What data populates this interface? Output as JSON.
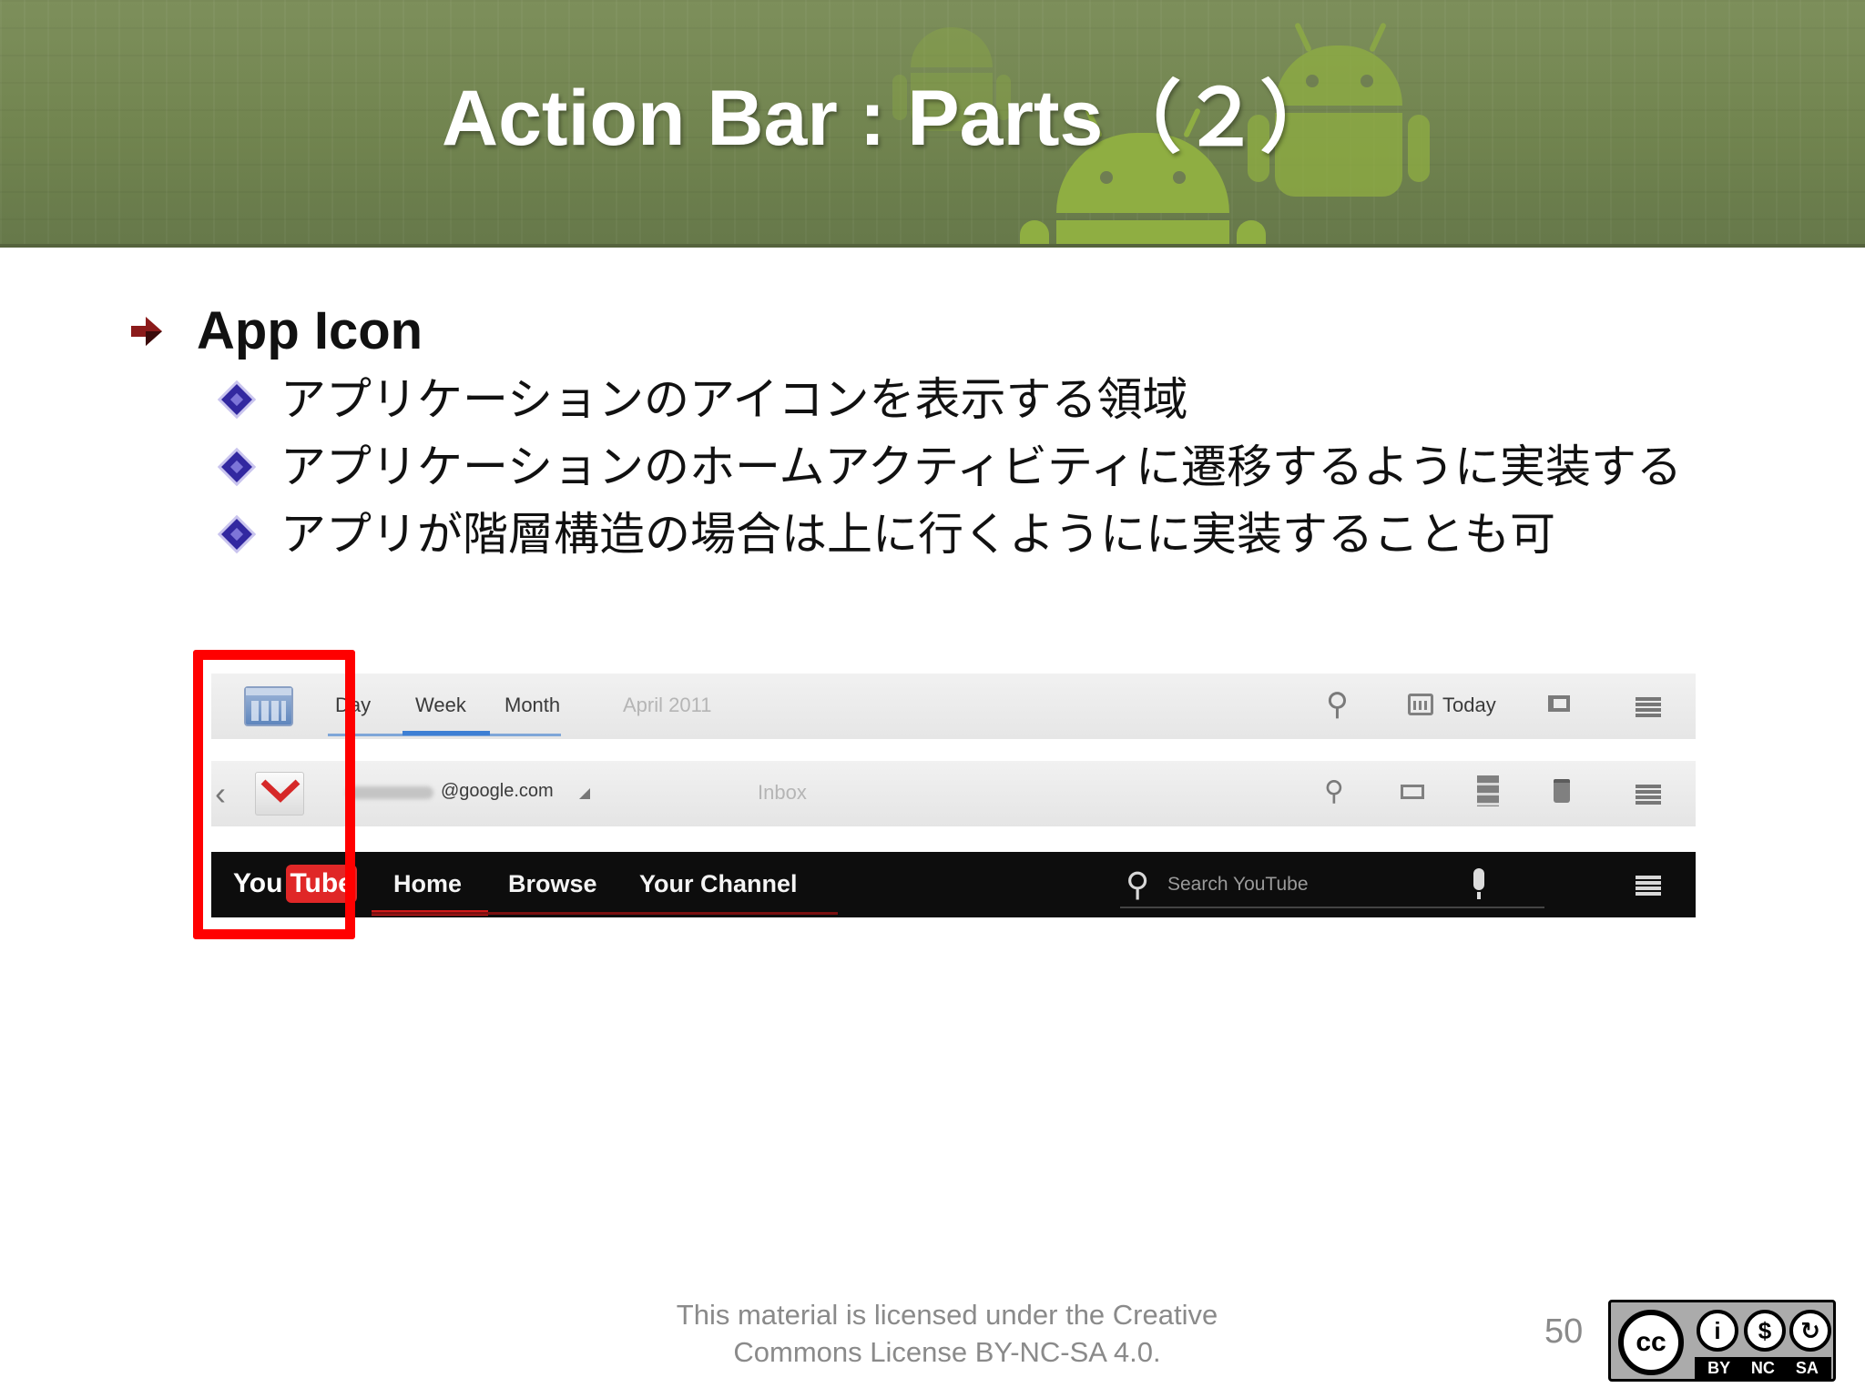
{
  "slide": {
    "title": "Action Bar : Parts（２）",
    "heading": "App Icon",
    "bullets": [
      "アプリケーションのアイコンを表示する領域",
      "アプリケーションのホームアクティビティに遷移するように実装する",
      "アプリが階層構造の場合は上に行くようにに実装することも可"
    ]
  },
  "calendar_bar": {
    "tabs": [
      "Day",
      "Week",
      "Month"
    ],
    "date": "April 2011",
    "today": "Today",
    "icons": [
      "calendar-app-icon",
      "search-icon",
      "today-calendar-icon",
      "crop-icon",
      "overflow-menu-icon"
    ]
  },
  "gmail_bar": {
    "account": "@google.com",
    "label": "Inbox",
    "icons": [
      "back-chevron-icon",
      "gmail-app-icon",
      "dropdown-triangle-icon",
      "search-icon",
      "compose-icon",
      "archive-icon",
      "trash-icon",
      "overflow-menu-icon"
    ]
  },
  "youtube_bar": {
    "logo_you": "You",
    "logo_tube": "Tube",
    "tabs": [
      "Home",
      "Browse",
      "Your Channel"
    ],
    "search_placeholder": "Search YouTube",
    "icons": [
      "search-icon",
      "microphone-icon",
      "overflow-menu-icon"
    ]
  },
  "footer": {
    "license_line1": "This material is licensed under the Creative",
    "license_line2": "Commons License BY-NC-SA 4.0.",
    "page_number": "50",
    "cc_badge": {
      "cc": "cc",
      "terms": "BY NC SA"
    }
  },
  "colors": {
    "banner": "#74864f",
    "highlight": "#ff0000",
    "bullet": "#3228a0",
    "arrow_bullet": "#8b1a1a"
  }
}
